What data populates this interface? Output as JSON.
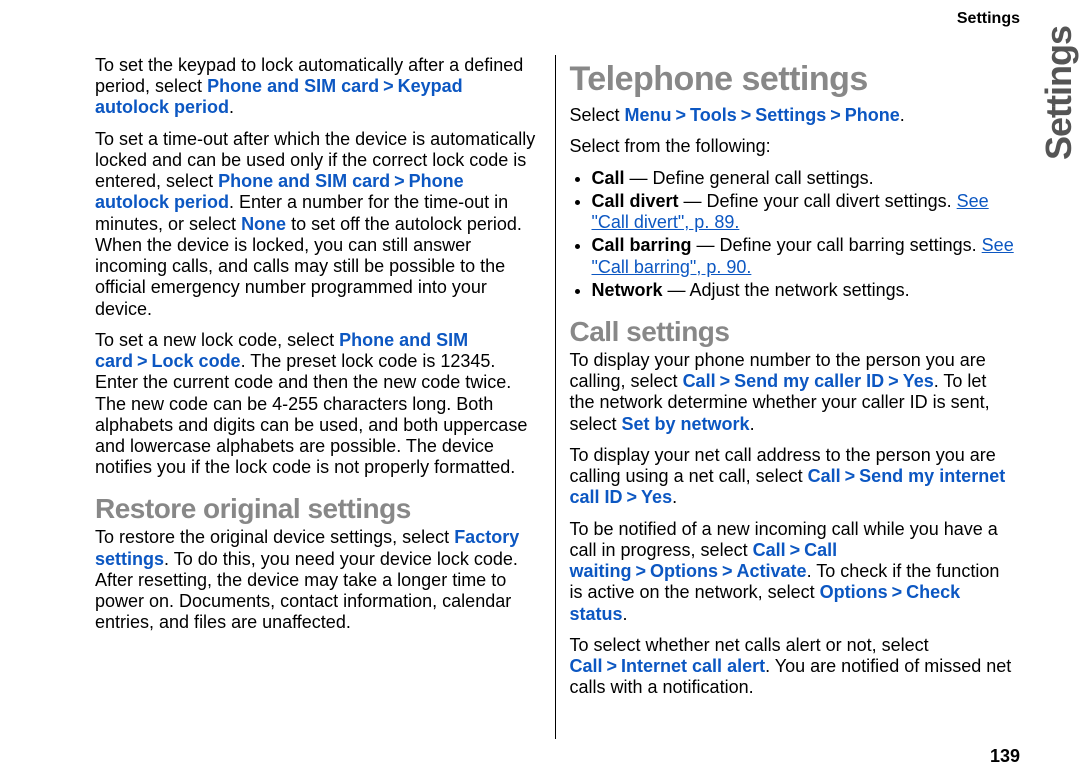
{
  "header": {
    "section": "Settings"
  },
  "sideTab": "Settings",
  "pageNumber": "139",
  "left": {
    "p1": {
      "t1": "To set the keypad to lock automatically after a defined period, select ",
      "l1": "Phone and SIM card",
      "sep": ">",
      "l2": "Keypad autolock period",
      "t2": "."
    },
    "p2": {
      "t1": "To set a time-out after which the device is automatically locked and can be used only if the correct lock code is entered, select ",
      "l1": "Phone and SIM card",
      "sep": ">",
      "l2": "Phone autolock period",
      "t2": ". Enter a number for the time-out in minutes, or select ",
      "l3": "None",
      "t3": " to set off the autolock period. When the device is locked, you can still answer incoming calls, and calls may still be possible to the official emergency number programmed into your device."
    },
    "p3": {
      "t1": "To set a new lock code, select ",
      "l1": "Phone and SIM card",
      "sep": ">",
      "l2": "Lock code",
      "t2": ". The preset lock code is 12345. Enter the current code and then the new code twice. The new code can be 4-255 characters long. Both alphabets and digits can be used, and both uppercase and lowercase alphabets are possible. The device notifies you if the lock code is not properly formatted."
    },
    "h2": "Restore original settings",
    "p4": {
      "t1": "To restore the original device settings, select ",
      "l1": "Factory settings",
      "t2": ". To do this, you need your device lock code. After resetting, the device may take a longer time to power on. Documents, contact information, calendar entries, and files are unaffected."
    }
  },
  "right": {
    "h1": "Telephone settings",
    "p1": {
      "t1": "Select ",
      "l1": "Menu",
      "sep": ">",
      "l2": "Tools",
      "l3": "Settings",
      "l4": "Phone",
      "t2": "."
    },
    "p2": "Select from the following:",
    "bullets": [
      {
        "b": "Call",
        "t": " — Define general call settings."
      },
      {
        "b": "Call divert",
        "t": " — Define your call divert settings. ",
        "see": "See \"Call divert\", p. 89."
      },
      {
        "b": "Call barring",
        "t": " — Define your call barring settings. ",
        "see": "See \"Call barring\", p. 90."
      },
      {
        "b": "Network",
        "t": " — Adjust the network settings."
      }
    ],
    "h2": "Call settings",
    "p3": {
      "t1": "To display your phone number to the person you are calling, select ",
      "l1": "Call",
      "sep": ">",
      "l2": "Send my caller ID",
      "l3": "Yes",
      "t2": ". To let the network determine whether your caller ID is sent, select ",
      "l4": "Set by network",
      "t3": "."
    },
    "p4": {
      "t1": "To display your net call address to the person you are calling using a net call, select ",
      "l1": "Call",
      "sep": ">",
      "l2": "Send my internet call ID",
      "l3": "Yes",
      "t2": "."
    },
    "p5": {
      "t1": "To be notified of a new incoming call while you have a call in progress, select ",
      "l1": "Call",
      "sep": ">",
      "l2": "Call waiting",
      "l3": "Options",
      "l4": "Activate",
      "t2": ". To check if the function is active on the network, select ",
      "l5": "Options",
      "l6": "Check status",
      "t3": "."
    },
    "p6": {
      "t1": "To select whether net calls alert or not, select ",
      "l1": "Call",
      "sep": ">",
      "l2": "Internet call alert",
      "t2": ". You are notified of missed net calls with a notification."
    }
  }
}
